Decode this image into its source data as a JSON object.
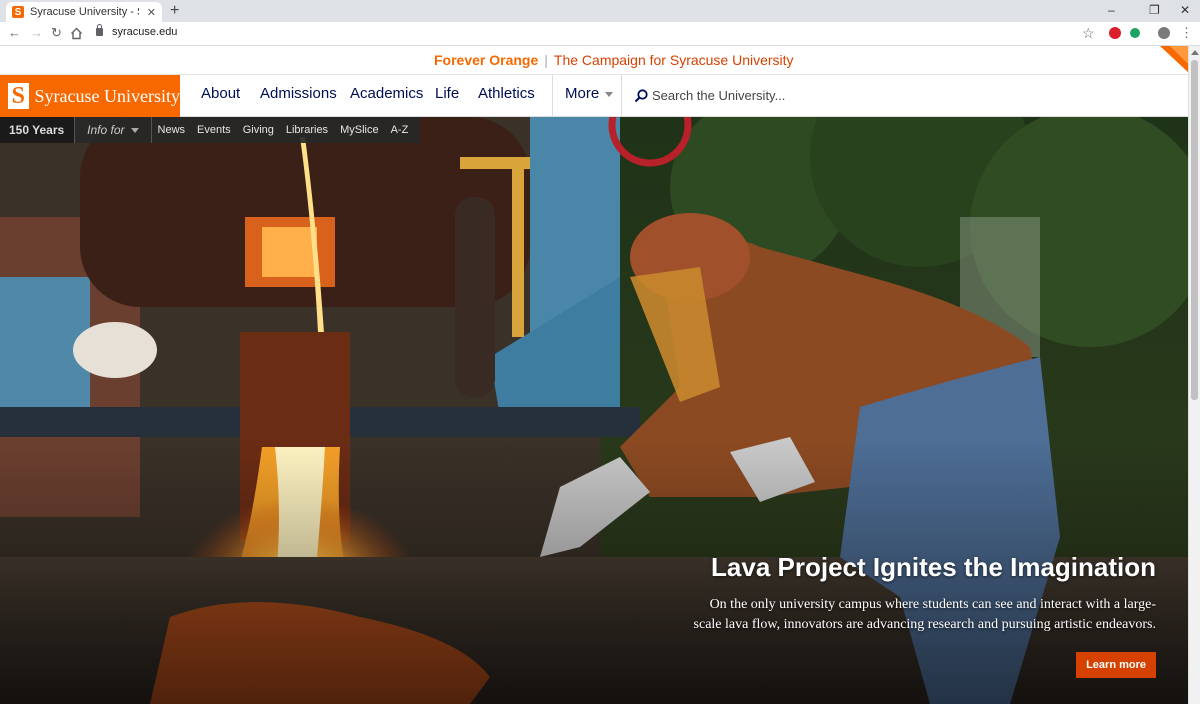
{
  "browser": {
    "tab_title": "Syracuse University - Syracuse.edu",
    "tab_favicon": "S",
    "new_tab": "+",
    "url": "syracuse.edu",
    "minimize": "–",
    "restore": "❐",
    "close": "✕"
  },
  "campaign": {
    "highlight": "Forever Orange",
    "separator": "|",
    "text": "The Campaign for Syracuse University"
  },
  "logo": {
    "mark": "S",
    "text": "Syracuse University"
  },
  "main_nav": {
    "items": [
      "About",
      "Admissions",
      "Academics",
      "Life",
      "Athletics"
    ],
    "more": "More",
    "search_placeholder": "Search the University..."
  },
  "sub_nav": {
    "anniversary": "150 Years",
    "info_for": "Info for",
    "links": [
      "News",
      "Events",
      "Giving",
      "Libraries",
      "MySlice",
      "A-Z"
    ]
  },
  "hero": {
    "title": "Lava Project Ignites the Imagination",
    "description": "On the only university campus where students can see and interact with a large-scale lava flow, innovators are advancing research and pursuing artistic endeavors.",
    "cta": "Learn more"
  },
  "colors": {
    "brand_orange": "#f76900",
    "campaign_red": "#d74100",
    "nav_navy": "#000e54"
  }
}
